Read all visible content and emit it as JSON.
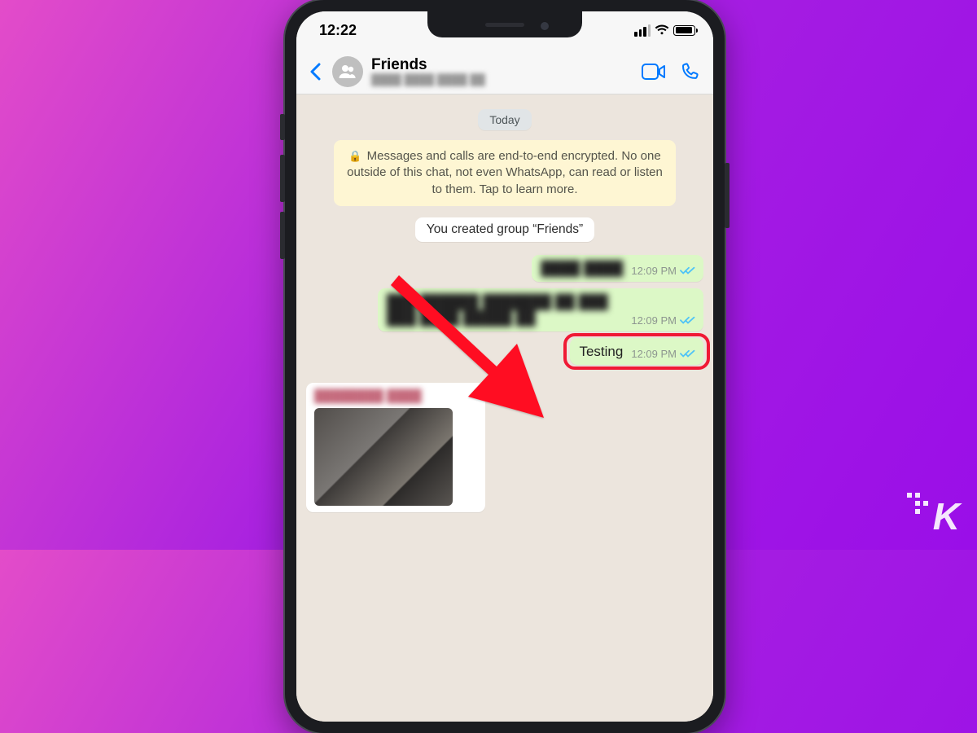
{
  "status": {
    "time": "12:22"
  },
  "header": {
    "chat_name": "Friends",
    "subtitle": "████ ████ ████ ██"
  },
  "date_label": "Today",
  "encryption_notice": "Messages and calls are end-to-end encrypted. No one outside of this chat, not even WhatsApp, can read or listen to them. Tap to learn more.",
  "system_message": "You created group “Friends”",
  "messages": [
    {
      "text": "████ ████",
      "time": "12:09 PM",
      "blurred": true
    },
    {
      "text": "███ ██████ ███████ ██ ███ ███ ████ █████ ██",
      "time": "12:09 PM",
      "blurred": true
    },
    {
      "text": "Testing",
      "time": "12:09 PM",
      "blurred": false,
      "highlighted": true
    }
  ],
  "incoming_stub": {
    "sender": "████████ ████"
  },
  "brand": "K",
  "colors": {
    "ios_blue": "#007AFF",
    "tick_blue": "#4FC3F7",
    "bubble_out": "#DCF8C6",
    "highlight": "#f01935"
  }
}
